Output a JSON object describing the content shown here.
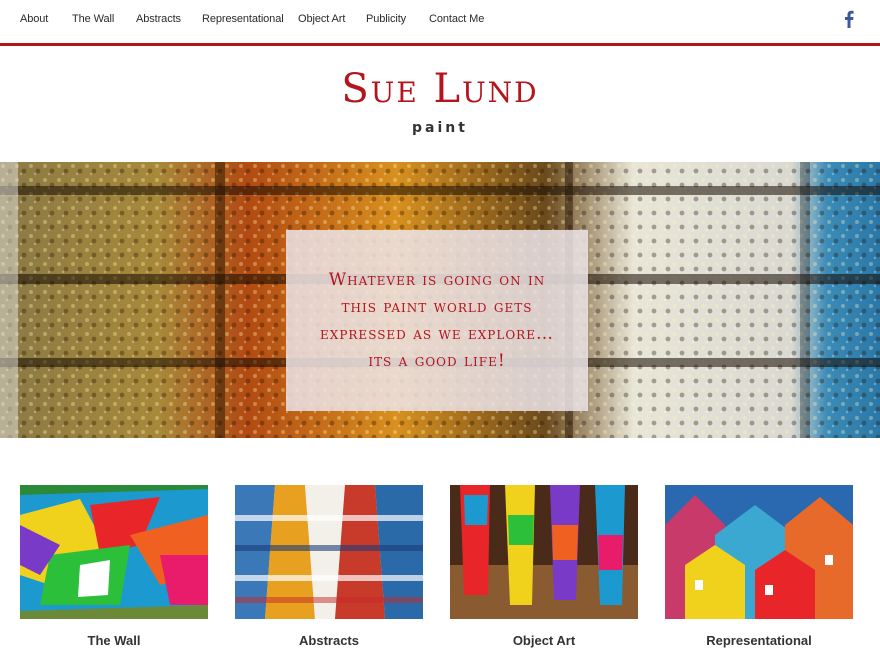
{
  "nav": {
    "items": [
      {
        "label": "About"
      },
      {
        "label": "The Wall"
      },
      {
        "label": "Abstracts"
      },
      {
        "label": "Representational"
      },
      {
        "label": "Object Art"
      },
      {
        "label": "Publicity"
      },
      {
        "label": "Contact Me"
      }
    ],
    "social_icon": "facebook-icon"
  },
  "header": {
    "title": "Sue Lund",
    "subtitle": "paint"
  },
  "hero": {
    "quote_lines": [
      "Whatever is going on in",
      "this paint world gets",
      "expressed as we explore…",
      "its a good life!"
    ]
  },
  "gallery": {
    "tiles": [
      {
        "caption": "The Wall"
      },
      {
        "caption": "Abstracts"
      },
      {
        "caption": "Object Art"
      },
      {
        "caption": "Representational"
      }
    ]
  },
  "colors": {
    "accent": "#b4141c",
    "facebook": "#3b5998"
  }
}
